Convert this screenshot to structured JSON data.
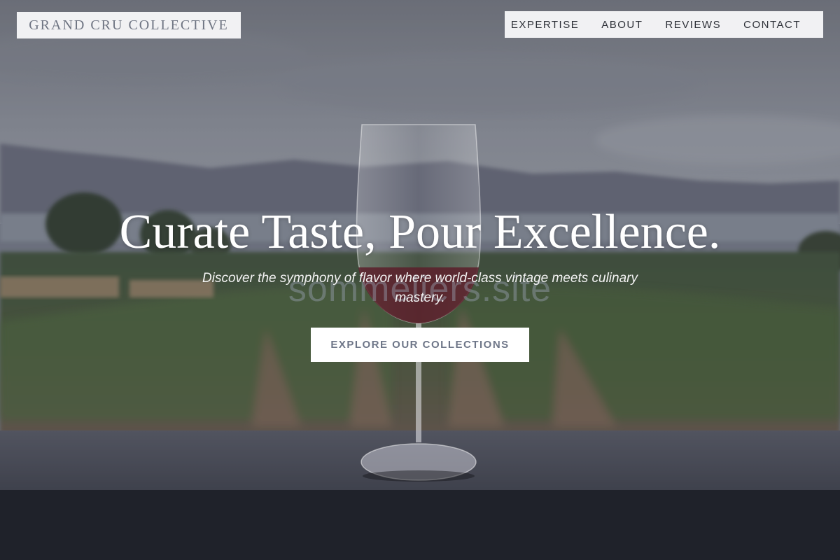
{
  "brand": {
    "name": "GRAND CRU COLLECTIVE"
  },
  "nav": {
    "items": [
      {
        "label": "EXPERTISE"
      },
      {
        "label": "ABOUT"
      },
      {
        "label": "REVIEWS"
      },
      {
        "label": "CONTACT"
      }
    ]
  },
  "hero": {
    "headline": "Curate Taste, Pour Excellence.",
    "subline": "Discover the symphony of flavor where world-class vintage meets culinary mastery.",
    "cta_label": "EXPLORE OUR COLLECTIONS",
    "watermark": "sommeliers.site",
    "background_image": "wine-glass-on-ledge-vineyard-photo"
  },
  "colors": {
    "overlay": "#4a4f5c",
    "brand_text": "#6e7482",
    "nav_text": "#2e3138",
    "cta_text": "#6e7688",
    "headline_text": "#ffffff"
  }
}
